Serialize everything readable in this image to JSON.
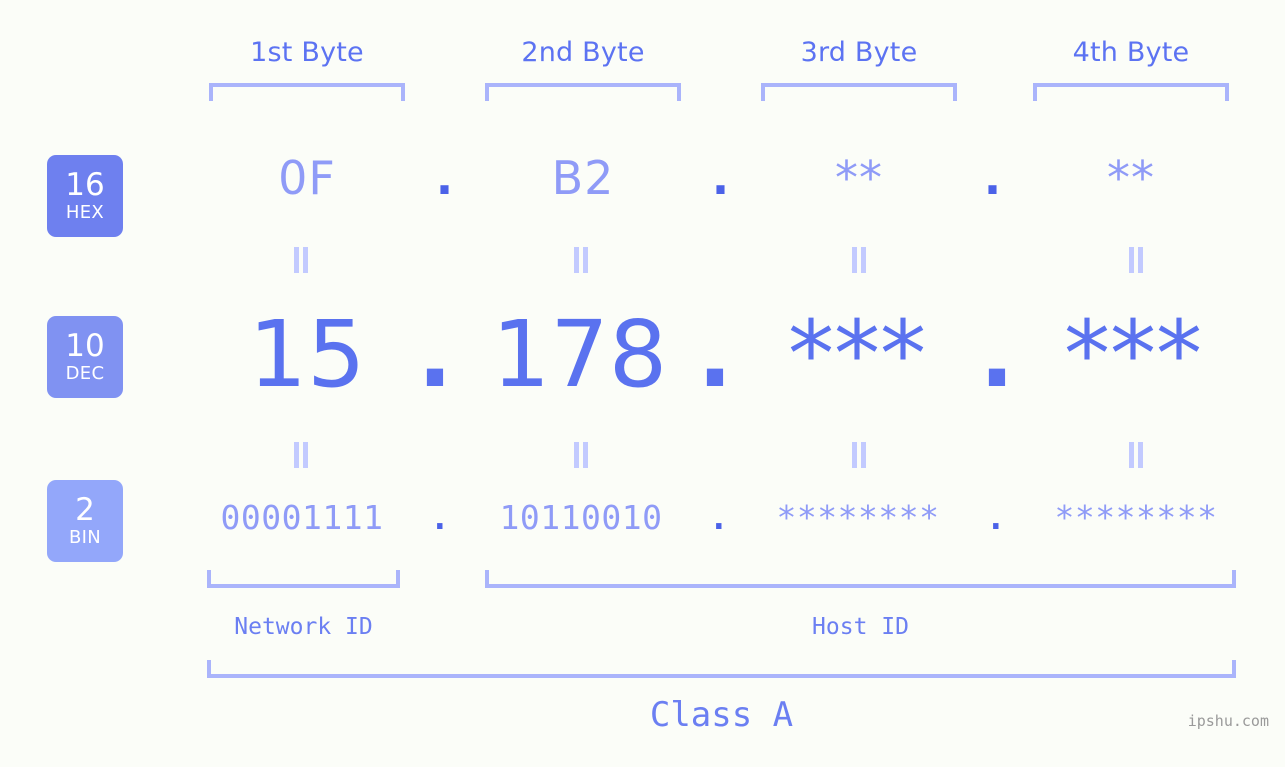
{
  "meta": {
    "background_color": "#fbfdf8",
    "accent_color": "#5c73f2",
    "light_accent_color": "#aab4fb",
    "muted_value_color": "#8f9bf7",
    "watermark": "ipshu.com"
  },
  "byte_headers": [
    {
      "label": "1st Byte"
    },
    {
      "label": "2nd Byte"
    },
    {
      "label": "3rd Byte"
    },
    {
      "label": "4th Byte"
    }
  ],
  "bases": [
    {
      "number": "16",
      "name": "HEX",
      "color": "#6e80ef"
    },
    {
      "number": "10",
      "name": "DEC",
      "color": "#8092f2"
    },
    {
      "number": "2",
      "name": "BIN",
      "color": "#93a7fa"
    }
  ],
  "rows": {
    "hex": {
      "base_number": "16",
      "base_name": "HEX",
      "values": [
        "0F",
        "B2",
        "**",
        "**"
      ],
      "separator": "."
    },
    "dec": {
      "base_number": "10",
      "base_name": "DEC",
      "values": [
        "15",
        "178",
        "***",
        "***"
      ],
      "separator": "."
    },
    "bin": {
      "base_number": "2",
      "base_name": "BIN",
      "values": [
        "00001111",
        "10110010",
        "********",
        "********"
      ],
      "separator": "."
    }
  },
  "segments": {
    "network_id": "Network ID",
    "host_id": "Host ID"
  },
  "class": {
    "label": "Class A"
  }
}
